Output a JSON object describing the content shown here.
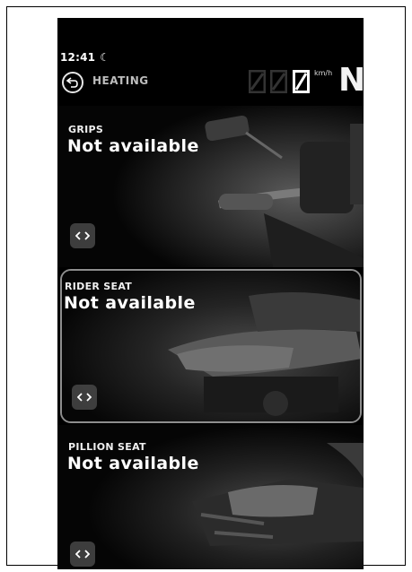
{
  "status": {
    "time": "12:41"
  },
  "header": {
    "title": "HEATING",
    "speed_unit": "km/h",
    "speed_digits": [
      "0",
      "0",
      "0"
    ],
    "gear": "N"
  },
  "cards": [
    {
      "label": "GRIPS",
      "value": "Not available"
    },
    {
      "label": "RIDER SEAT",
      "value": "Not available",
      "selected": true
    },
    {
      "label": "PILLION SEAT",
      "value": "Not available"
    }
  ],
  "icons": {
    "back": "back-arrow-icon",
    "moon": "moon-icon",
    "arrows": "left-right-arrows-icon"
  },
  "colors": {
    "background": "#000000",
    "text": "#ffffff",
    "selected_border": "#8e8e8e"
  }
}
